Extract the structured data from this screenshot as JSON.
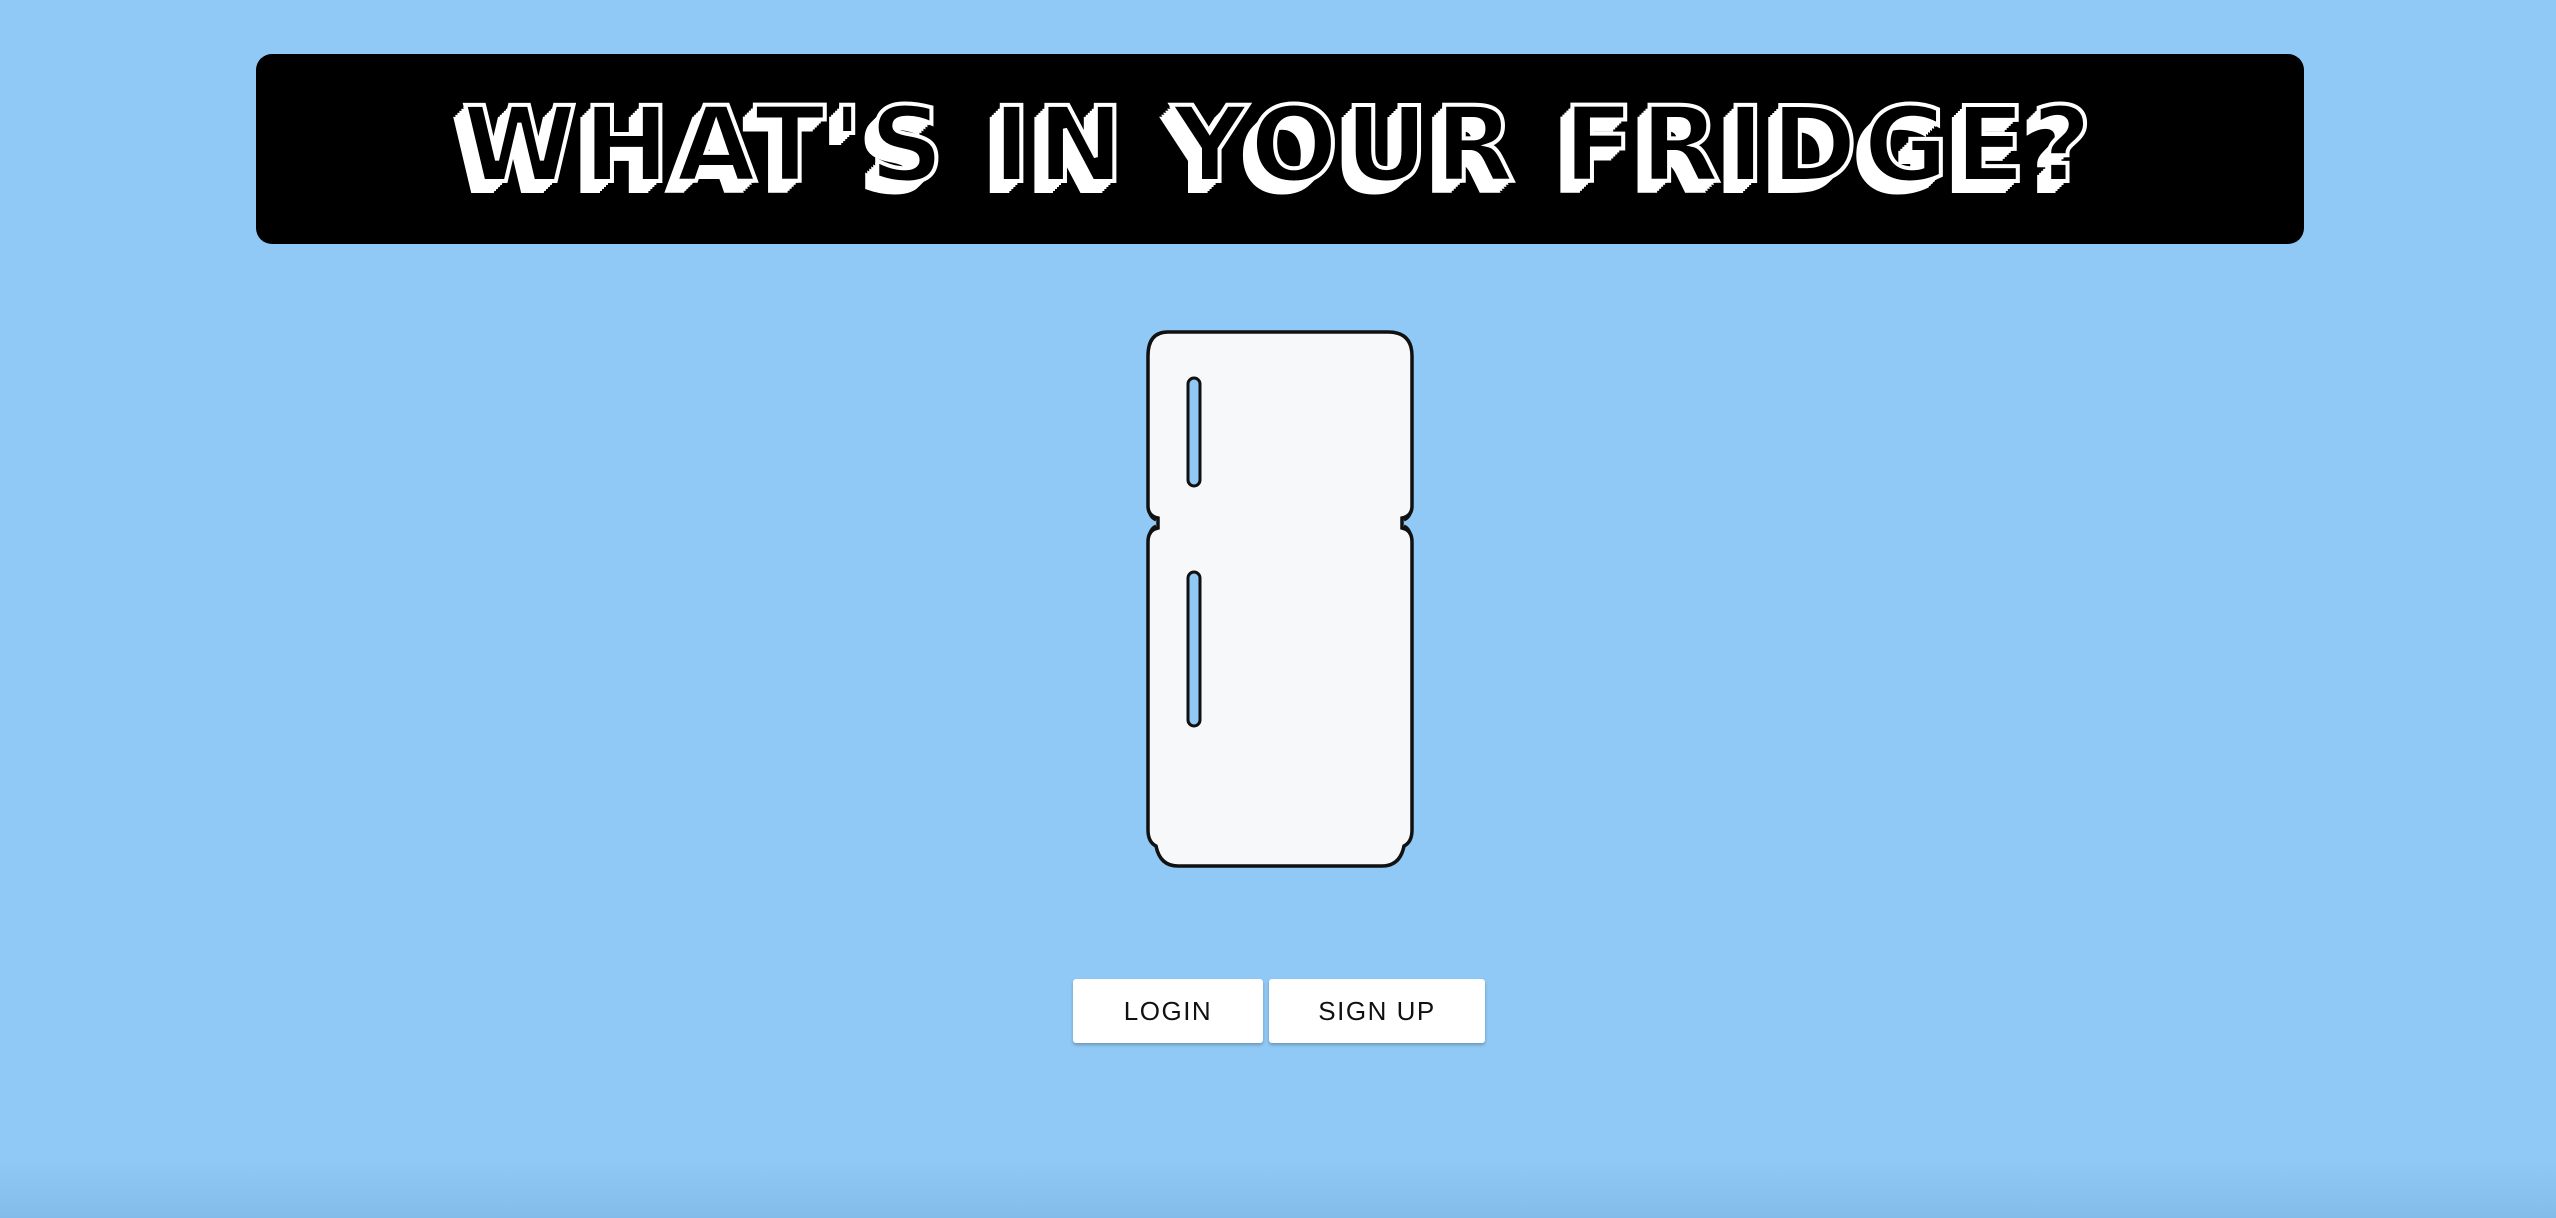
{
  "header": {
    "title": "WHAT'S IN YOUR FRIDGE?"
  },
  "illustration": {
    "icon": "fridge-icon"
  },
  "actions": {
    "login_label": "LOGIN",
    "signup_label": "SIGN UP"
  },
  "colors": {
    "background": "#90c9f6",
    "banner": "#000000",
    "fridge_body": "#f7f8fa",
    "fridge_handle": "#90c9f6",
    "button": "#ffffff"
  }
}
